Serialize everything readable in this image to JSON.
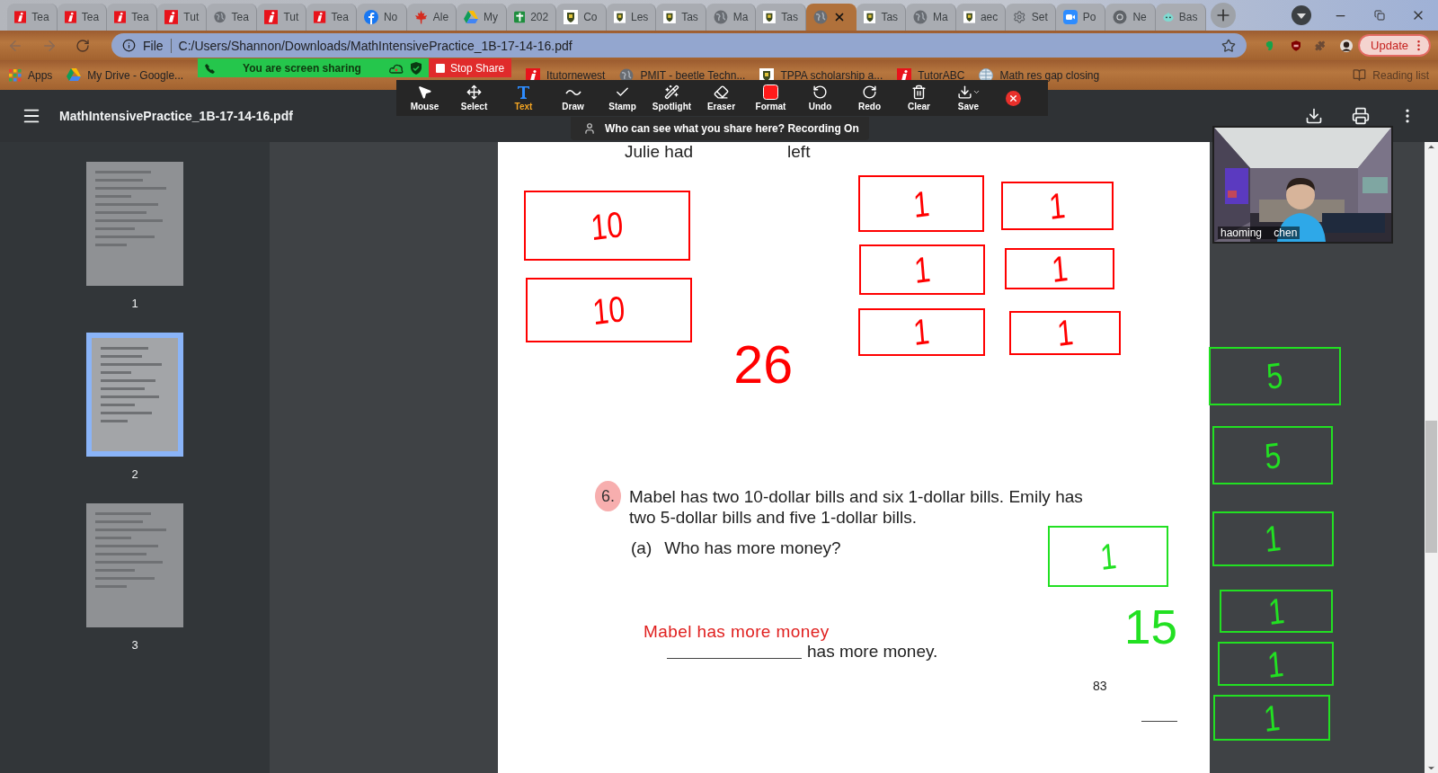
{
  "browser": {
    "tabs": [
      {
        "kind": "itutor",
        "title": "Tea",
        "selected": false
      },
      {
        "kind": "itutor",
        "title": "Tea",
        "selected": false
      },
      {
        "kind": "itutor",
        "title": "Tea",
        "selected": false
      },
      {
        "kind": "itutor",
        "title": "Tut",
        "selected": false
      },
      {
        "kind": "globe",
        "title": "Tea",
        "selected": false
      },
      {
        "kind": "itutor",
        "title": "Tut",
        "selected": false
      },
      {
        "kind": "itutor",
        "title": "Tea",
        "selected": false
      },
      {
        "kind": "facebook",
        "title": "No",
        "selected": false
      },
      {
        "kind": "maple",
        "title": "Ale",
        "selected": false
      },
      {
        "kind": "drive",
        "title": "My",
        "selected": false
      },
      {
        "kind": "sheets",
        "title": "202",
        "selected": false
      },
      {
        "kind": "crest",
        "title": "Co",
        "selected": false
      },
      {
        "kind": "crest",
        "title": "Les",
        "selected": false
      },
      {
        "kind": "crest",
        "title": "Tas",
        "selected": false
      },
      {
        "kind": "globe",
        "title": "Ma",
        "selected": false
      },
      {
        "kind": "crest",
        "title": "Tas",
        "selected": false
      },
      {
        "kind": "globe",
        "selected": true
      },
      {
        "kind": "crest",
        "title": "Tas",
        "selected": false
      },
      {
        "kind": "globe",
        "title": "Ma",
        "selected": false
      },
      {
        "kind": "crest",
        "title": "aec",
        "selected": false
      },
      {
        "kind": "gear",
        "title": "Set",
        "selected": false
      },
      {
        "kind": "zoom",
        "title": "Po",
        "selected": false
      },
      {
        "kind": "chrome",
        "title": "Ne",
        "selected": false
      },
      {
        "kind": "bot",
        "title": "Bas",
        "selected": false
      }
    ],
    "address": {
      "scheme": "File",
      "url": "C:/Users/Shannon/Downloads/MathIntensivePractice_1B-17-14-16.pdf"
    },
    "update_button": "Update",
    "bookmarks_bar": {
      "items_before": [
        {
          "kind": "apps",
          "label": "Apps"
        },
        {
          "kind": "drive",
          "label": "My Drive - Google..."
        }
      ],
      "share_bar": {
        "status": "You are screen sharing",
        "stop": "Stop Share"
      },
      "items_after": [
        {
          "kind": "itutor",
          "label": "Itutornewest"
        },
        {
          "kind": "globe",
          "label": "PMIT - beetle Techn..."
        },
        {
          "kind": "crest",
          "label": "TPPA scholarship a..."
        },
        {
          "kind": "itutor",
          "label": "TutorABC"
        },
        {
          "kind": "world",
          "label": "Math res gap closing"
        }
      ],
      "reading_list": "Reading list"
    }
  },
  "zoom_toolbar": {
    "tools": [
      {
        "kind": "pointer",
        "label": "Mouse",
        "selected": false
      },
      {
        "kind": "move",
        "label": "Select",
        "selected": false
      },
      {
        "kind": "text",
        "label": "Text",
        "selected": true
      },
      {
        "kind": "draw",
        "label": "Draw",
        "selected": false
      },
      {
        "kind": "check",
        "label": "Stamp",
        "selected": false
      },
      {
        "kind": "wand",
        "label": "Spotlight",
        "selected": false
      },
      {
        "kind": "eraser",
        "label": "Eraser",
        "selected": false
      },
      {
        "kind": "format",
        "label": "Format",
        "selected": false
      },
      {
        "kind": "undo",
        "label": "Undo",
        "selected": false
      },
      {
        "kind": "redo",
        "label": "Redo",
        "selected": false
      },
      {
        "kind": "trash",
        "label": "Clear",
        "selected": false
      },
      {
        "kind": "save",
        "label": "Save",
        "selected": false
      }
    ],
    "notice": "Who can see what you share here? Recording On"
  },
  "pdf": {
    "title": "MathIntensivePractice_1B-17-14-16.pdf",
    "thumbnails": [
      {
        "number": "1",
        "selected": false
      },
      {
        "number": "2",
        "selected": true
      },
      {
        "number": "3",
        "selected": false
      }
    ],
    "page": {
      "top_texts": [
        "Julie had",
        "left"
      ],
      "question_number": "6.",
      "question": "Mabel has two 10-dollar bills and six 1-dollar bills. Emily has two 5-dollar bills and five 1-dollar bills.",
      "part_label": "(a)",
      "part_question": "Who has more money?",
      "typed_answer": "Mabel has more money",
      "answer_suffix": "has more money.",
      "page_number": "83"
    }
  },
  "video": {
    "name": "haoming chen"
  },
  "annotations": [
    {
      "kind": "box",
      "label": "10",
      "color": "#ff0000"
    },
    {
      "kind": "box",
      "label": "10",
      "color": "#ff0000"
    },
    {
      "kind": "box",
      "label": "1",
      "color": "#ff0000"
    },
    {
      "kind": "box",
      "label": "1",
      "color": "#ff0000"
    },
    {
      "kind": "box",
      "label": "1",
      "color": "#ff0000"
    },
    {
      "kind": "box",
      "label": "1",
      "color": "#ff0000"
    },
    {
      "kind": "box",
      "label": "1",
      "color": "#ff0000"
    },
    {
      "kind": "box",
      "label": "1",
      "color": "#ff0000"
    },
    {
      "kind": "text",
      "label": "26",
      "color": "#ff0000"
    },
    {
      "kind": "box",
      "label": "5",
      "color": "#22e022"
    },
    {
      "kind": "box",
      "label": "5",
      "color": "#22e022"
    },
    {
      "kind": "box",
      "label": "1",
      "color": "#22e022"
    },
    {
      "kind": "box",
      "label": "1",
      "color": "#22e022"
    },
    {
      "kind": "box",
      "label": "1",
      "color": "#22e022"
    },
    {
      "kind": "box",
      "label": "1",
      "color": "#22e022"
    },
    {
      "kind": "box",
      "label": "1",
      "color": "#22e022"
    },
    {
      "kind": "text",
      "label": "15",
      "color": "#22e022"
    }
  ]
}
